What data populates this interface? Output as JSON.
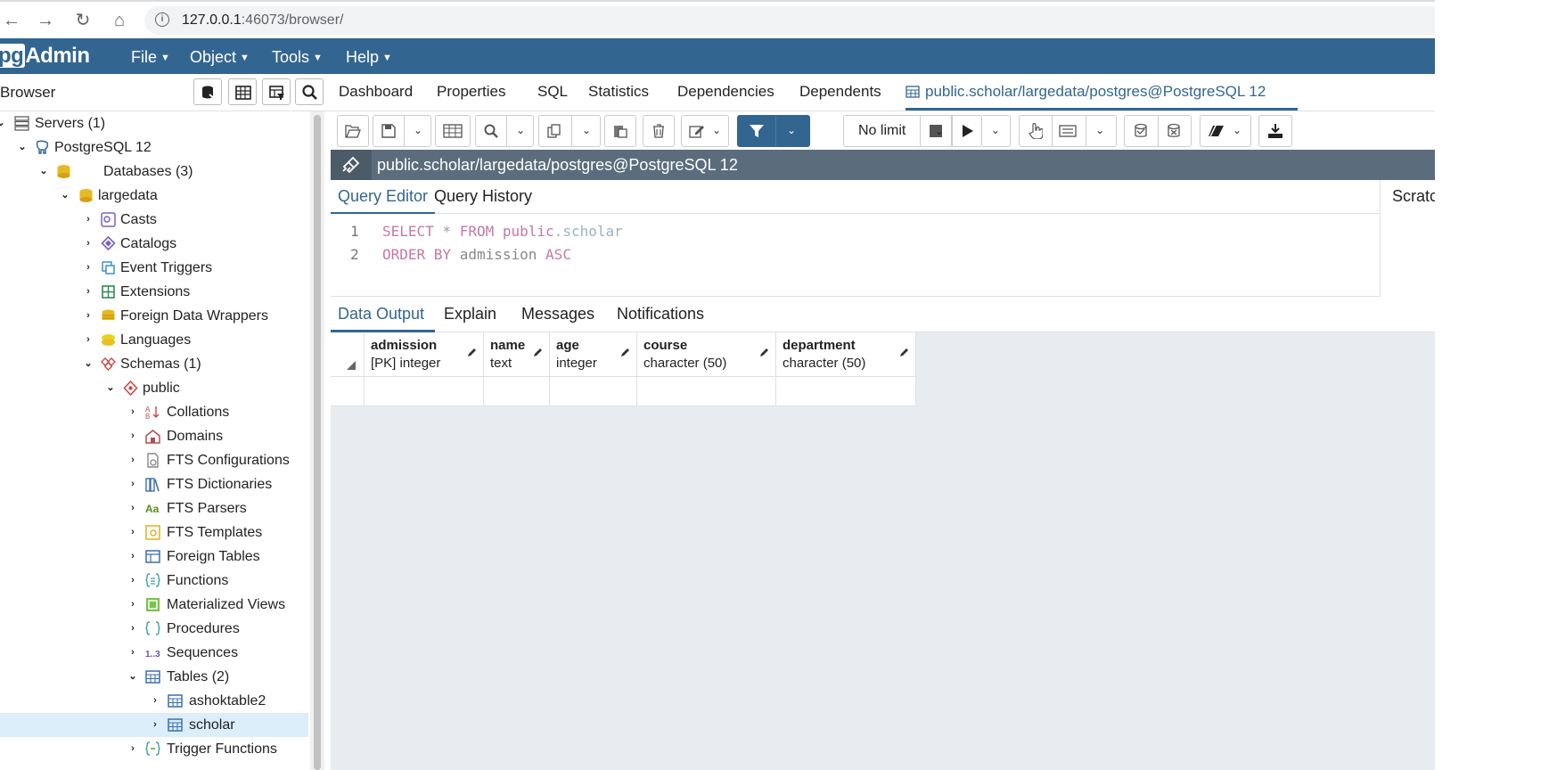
{
  "browser": {
    "url_host": "127.0.0.1",
    "url_rest": ":46073/browser/"
  },
  "navbar": {
    "logo_pg": "pg",
    "logo_rest": "Admin",
    "menus": [
      "File",
      "Object",
      "Tools",
      "Help"
    ]
  },
  "left_panel": {
    "title": "Browser",
    "tree": [
      {
        "label": "Servers (1)"
      },
      {
        "label": "PostgreSQL 12"
      },
      {
        "label": "Databases (3)"
      },
      {
        "label": "largedata"
      },
      {
        "label": "Casts"
      },
      {
        "label": "Catalogs"
      },
      {
        "label": "Event Triggers"
      },
      {
        "label": "Extensions"
      },
      {
        "label": "Foreign Data Wrappers"
      },
      {
        "label": "Languages"
      },
      {
        "label": "Schemas (1)"
      },
      {
        "label": "public"
      },
      {
        "label": "Collations"
      },
      {
        "label": "Domains"
      },
      {
        "label": "FTS Configurations"
      },
      {
        "label": "FTS Dictionaries"
      },
      {
        "label": "FTS Parsers"
      },
      {
        "label": "FTS Templates"
      },
      {
        "label": "Foreign Tables"
      },
      {
        "label": "Functions"
      },
      {
        "label": "Materialized Views"
      },
      {
        "label": "Procedures"
      },
      {
        "label": "Sequences"
      },
      {
        "label": "Tables (2)"
      },
      {
        "label": "ashoktable2"
      },
      {
        "label": "scholar"
      },
      {
        "label": "Trigger Functions"
      }
    ]
  },
  "main_tabs": [
    "Dashboard",
    "Properties",
    "SQL",
    "Statistics",
    "Dependencies",
    "Dependents",
    "public.scholar/largedata/postgres@PostgreSQL 12"
  ],
  "toolbar": {
    "limit": "No limit"
  },
  "connection": {
    "label": "public.scholar/largedata/postgres@PostgreSQL 12"
  },
  "query_tabs": [
    "Query Editor",
    "Query History"
  ],
  "scratch_label": "Scratch",
  "editor": {
    "line_numbers": [
      "1",
      "2"
    ],
    "line1": {
      "select": "SELECT",
      "star": "*",
      "from": "FROM",
      "schema": "public",
      "dot_table": ".scholar"
    },
    "line2": {
      "order": "ORDER BY",
      "col": "admission",
      "dir": "ASC"
    }
  },
  "data_tabs": [
    "Data Output",
    "Explain",
    "Messages",
    "Notifications"
  ],
  "grid": {
    "columns": [
      {
        "name": "admission",
        "type": "[PK] integer"
      },
      {
        "name": "name",
        "type": "text"
      },
      {
        "name": "age",
        "type": "integer"
      },
      {
        "name": "course",
        "type": "character (50)"
      },
      {
        "name": "department",
        "type": "character (50)"
      }
    ]
  },
  "colors": {
    "brand": "#326690",
    "selection": "#dbeefa",
    "keyword": "#c678a6"
  }
}
